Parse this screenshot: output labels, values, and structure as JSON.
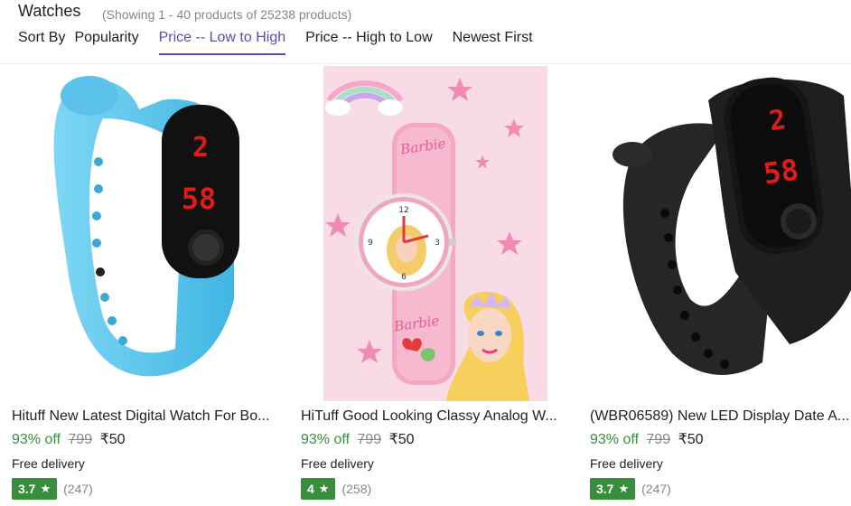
{
  "header": {
    "title": "Watches",
    "count": "(Showing 1 - 40 products of 25238 products)",
    "sort_label": "Sort By",
    "sort_options": [
      "Popularity",
      "Price -- Low to High",
      "Price -- High to Low",
      "Newest First"
    ],
    "active_sort": "Price -- Low to High"
  },
  "colors": {
    "accent": "#5b4bb7",
    "discount_green": "#388e3c",
    "muted": "#878787"
  },
  "products": [
    {
      "name": "Hituff New Latest Digital Watch For Bo...",
      "discount": "93% off",
      "mrp": "799",
      "price": "₹50",
      "delivery": "Free delivery",
      "rating": "3.7",
      "reviews": "(247)",
      "display_hour": "2",
      "display_min": "58",
      "strap_color": "#5fc6ec"
    },
    {
      "name": "HiTuff Good Looking Classy Analog W...",
      "discount": "93% off",
      "mrp": "799",
      "price": "₹50",
      "delivery": "Free delivery",
      "rating": "4",
      "reviews": "(258)",
      "brand_text": "Barbie",
      "strap_color": "#f4a8c2"
    },
    {
      "name": "(WBR06589) New LED Display Date A...",
      "discount": "93% off",
      "mrp": "799",
      "price": "₹50",
      "delivery": "Free delivery",
      "rating": "3.7",
      "reviews": "(247)",
      "display_hour": "2",
      "display_min": "58",
      "strap_color": "#1f1f1f"
    }
  ]
}
